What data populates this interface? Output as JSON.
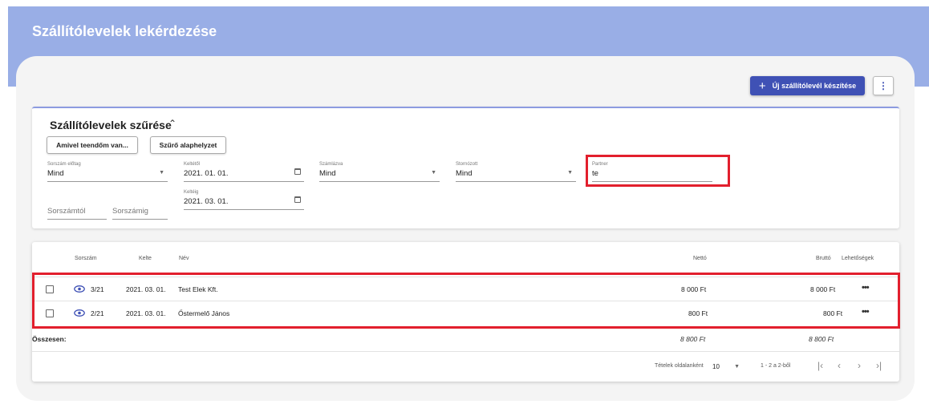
{
  "header": {
    "title": "Szállítólevelek lekérdezése"
  },
  "toolbar": {
    "new_label": "Új szállítólevél készítése",
    "new_icon": "plus-icon",
    "more_icon": "more-vert-icon"
  },
  "filter": {
    "title": "Szállítólevelek szűrése",
    "btn_todo": "Amivel teendőm van...",
    "btn_reset": "Szűrő alaphelyzet",
    "prefix": {
      "label": "Sorszám előtag",
      "value": "Mind"
    },
    "date_from": {
      "label": "Keltétől",
      "value": "2021. 01. 01."
    },
    "invoiced": {
      "label": "Számlázva",
      "value": "Mind"
    },
    "cancelled": {
      "label": "Stornózott",
      "value": "Mind"
    },
    "partner": {
      "label": "Partner",
      "value": "te"
    },
    "serial_from": {
      "placeholder": "Sorszámtól"
    },
    "serial_to": {
      "placeholder": "Sorszámig"
    },
    "date_to": {
      "label": "Keltéig",
      "value": "2021. 03. 01."
    }
  },
  "table": {
    "headers": {
      "serial": "Sorszám",
      "date": "Kelte",
      "name": "Név",
      "net": "Nettó",
      "gross": "Bruttó",
      "options": "Lehetőségek"
    },
    "rows": [
      {
        "serial": "3/21",
        "date": "2021. 03. 01.",
        "name": "Test Elek Kft.",
        "net": "8 000 Ft",
        "gross": "8 000 Ft"
      },
      {
        "serial": "2/21",
        "date": "2021. 03. 01.",
        "name": "Őstermelő János",
        "net": "800 Ft",
        "gross": "800 Ft"
      }
    ],
    "total": {
      "label": "Összesen:",
      "net": "8 800 Ft",
      "gross": "8 800 Ft"
    },
    "pager": {
      "per_page_label": "Tételek oldalanként",
      "per_page": "10",
      "range": "1 - 2 a 2-ből"
    }
  },
  "colors": {
    "header_bg": "#99aee6",
    "accent": "#3f51b5",
    "highlight": "#e21f2d"
  }
}
